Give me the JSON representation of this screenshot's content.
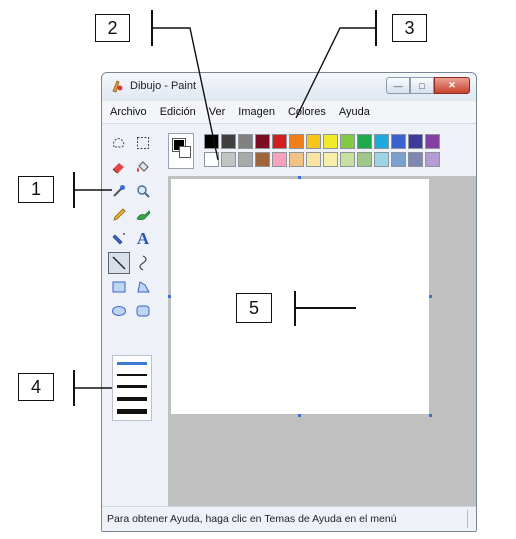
{
  "window": {
    "title": "Dibujo - Paint"
  },
  "menu": {
    "items": [
      "Archivo",
      "Edición",
      "Ver",
      "Imagen",
      "Colores",
      "Ayuda"
    ]
  },
  "tools": [
    {
      "name": "free-select-icon"
    },
    {
      "name": "rect-select-icon"
    },
    {
      "name": "eraser-icon"
    },
    {
      "name": "fill-bucket-icon"
    },
    {
      "name": "color-picker-icon"
    },
    {
      "name": "magnifier-icon"
    },
    {
      "name": "pencil-icon"
    },
    {
      "name": "brush-icon"
    },
    {
      "name": "airbrush-icon"
    },
    {
      "name": "text-icon"
    },
    {
      "name": "line-icon"
    },
    {
      "name": "curve-icon"
    },
    {
      "name": "rectangle-icon"
    },
    {
      "name": "polygon-icon"
    },
    {
      "name": "ellipse-icon"
    },
    {
      "name": "rounded-rectangle-icon"
    }
  ],
  "tool_labels": {
    "text": "A"
  },
  "palette": {
    "foreground": "#000000",
    "background": "#ffffff",
    "row1": [
      "#000000",
      "#404040",
      "#808080",
      "#7b0c21",
      "#d21e1e",
      "#ef7f1a",
      "#f6c61d",
      "#f1ea2c",
      "#83c942",
      "#1daa4c",
      "#1eaadd",
      "#3b62ce",
      "#3d3b9a",
      "#843fa3"
    ],
    "row2": [
      "#ffffff",
      "#c3c3c3",
      "#a9a9a9",
      "#a0643b",
      "#f3a3bd",
      "#f1c283",
      "#fbe3a2",
      "#f5f0a5",
      "#c9dfa0",
      "#9ec789",
      "#9dd5e6",
      "#7aa0cd",
      "#7f87b1",
      "#b49bd3"
    ]
  },
  "status": {
    "text": "Para obtener Ayuda, haga clic en Temas de Ayuda en el menú"
  },
  "callouts": [
    "1",
    "2",
    "3",
    "4",
    "5"
  ]
}
